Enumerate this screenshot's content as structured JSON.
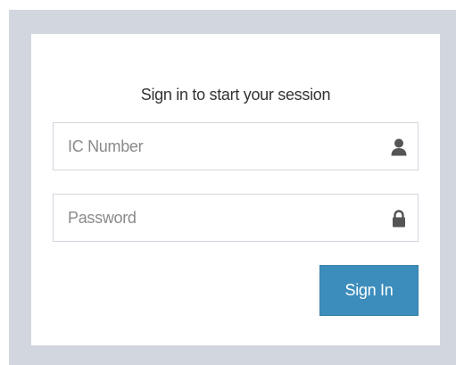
{
  "login": {
    "message": "Sign in to start your session",
    "ic_number": {
      "placeholder": "IC Number",
      "value": "",
      "icon": "user-icon"
    },
    "password": {
      "placeholder": "Password",
      "value": "",
      "icon": "lock-icon"
    },
    "signin_label": "Sign In"
  },
  "colors": {
    "page_background": "#d2d6de",
    "box_background": "#ffffff",
    "accent": "#3c8dbc",
    "input_border": "#d2d6de",
    "icon": "#555555"
  }
}
